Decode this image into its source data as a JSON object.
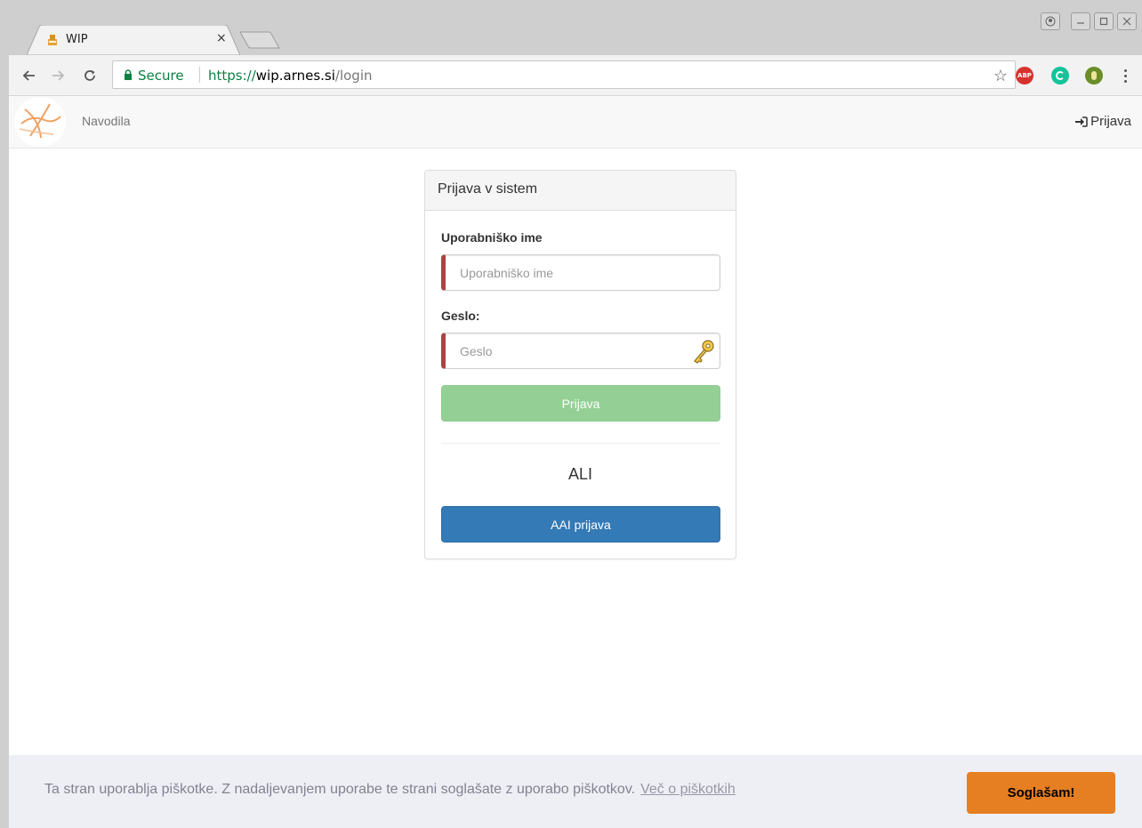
{
  "browser": {
    "tab_title": "WIP",
    "tab_close": "×",
    "secure_label": "Secure",
    "url_scheme": "https://",
    "url_host": "wip.arnes.si",
    "url_path": "/login",
    "extensions": [
      "adblock-plus",
      "grammarly",
      "vpn"
    ],
    "abp_label": "ABP"
  },
  "navbar": {
    "docs_link": "Navodila",
    "login_link": "Prijava"
  },
  "login_panel": {
    "heading": "Prijava v sistem",
    "username_label": "Uporabniško ime",
    "username_placeholder": "Uporabniško ime",
    "password_label": "Geslo:",
    "password_placeholder": "Geslo",
    "submit_label": "Prijava",
    "or_text": "ALI",
    "aai_label": "AAI prijava"
  },
  "cookie_bar": {
    "message": "Ta stran uporablja piškotke. Z nadaljevanjem uporabe te strani soglašate z uporabo piškotkov.",
    "link_text": "Več o piškotkih",
    "accept_label": "Soglašam!"
  },
  "colors": {
    "accent_primary": "#337ab7",
    "accent_success": "#94d095",
    "input_error_border": "#a94442",
    "cookie_button": "#e67e22",
    "secure_green": "#0b8043"
  }
}
